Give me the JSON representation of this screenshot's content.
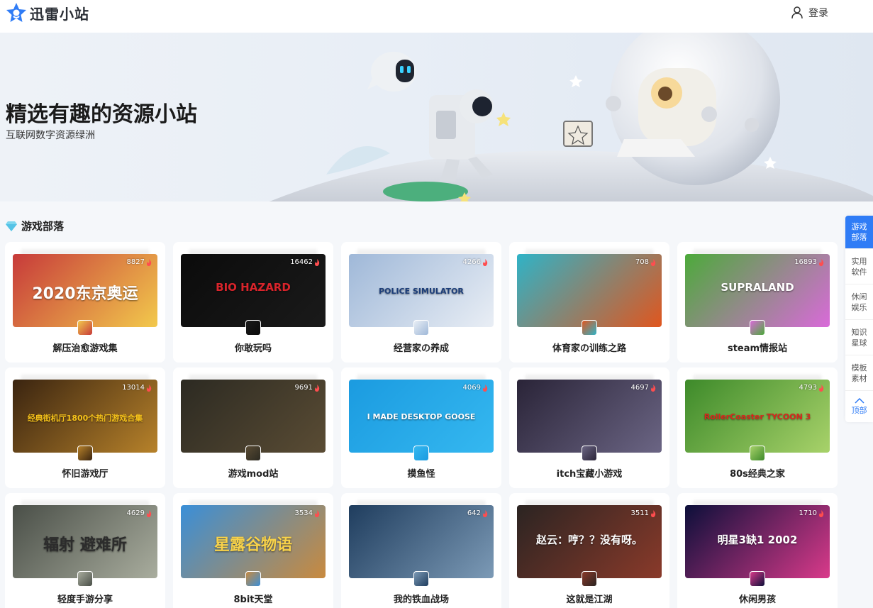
{
  "header": {
    "logo_text": "迅雷小站",
    "logo_icon": "star-shield-icon",
    "login_label": "登录",
    "login_icon": "user-icon",
    "brand_color": "#2f7cf6"
  },
  "banner": {
    "title": "精选有趣的资源小站",
    "subtitle": "互联网数字资源绿洲"
  },
  "section": {
    "title": "游戏部落",
    "icon": "diamond-icon"
  },
  "cards": [
    {
      "name": "解压治愈游戏集",
      "count": "8827",
      "thumb_text": "2020东京奥运",
      "bg": "#c73a3a",
      "bg2": "#f2c94c",
      "text_color": "#ffffff"
    },
    {
      "name": "你敢玩吗",
      "count": "16462",
      "thumb_text": "BIO HAZARD",
      "bg": "#0b0b0b",
      "bg2": "#1a1a1a",
      "text_color": "#d9242b"
    },
    {
      "name": "经营家の养成",
      "count": "4266",
      "thumb_text": "POLICE SIMULATOR",
      "bg": "#9fb8d8",
      "bg2": "#e9eef5",
      "text_color": "#1c3e7a"
    },
    {
      "name": "体育家の训练之路",
      "count": "708",
      "thumb_text": "",
      "bg": "#2fb3c7",
      "bg2": "#e0561e",
      "text_color": "#ffffff"
    },
    {
      "name": "steam情报站",
      "count": "16893",
      "thumb_text": "SUPRALAND",
      "bg": "#4caa3a",
      "bg2": "#d96ad9",
      "text_color": "#ffffff"
    },
    {
      "name": "怀旧游戏厅",
      "count": "13014",
      "thumb_text": "经典街机厅1800个热门游戏合集",
      "bg": "#3a2410",
      "bg2": "#b7822a",
      "text_color": "#f6c21a"
    },
    {
      "name": "游戏mod站",
      "count": "9691",
      "thumb_text": "",
      "bg": "#2c2a22",
      "bg2": "#5a4c34",
      "text_color": "#ffffff"
    },
    {
      "name": "摸鱼怪",
      "count": "4069",
      "thumb_text": "I MADE DESKTOP GOOSE",
      "bg": "#1b9be0",
      "bg2": "#35b8f0",
      "text_color": "#ffffff"
    },
    {
      "name": "itch宝藏小游戏",
      "count": "4697",
      "thumb_text": "",
      "bg": "#2a2438",
      "bg2": "#6b6584",
      "text_color": "#ffffff"
    },
    {
      "name": "80s经典之家",
      "count": "4793",
      "thumb_text": "RollerCoaster TYCOON 3",
      "bg": "#3d8a2a",
      "bg2": "#a8d26a",
      "text_color": "#d9261c"
    },
    {
      "name": "轻度手游分享",
      "count": "4629",
      "thumb_text": "辐射 避难所",
      "bg": "#4a4f48",
      "bg2": "#a9ad9e",
      "text_color": "#2c2c2c"
    },
    {
      "name": "8bit天堂",
      "count": "3534",
      "thumb_text": "星露谷物语",
      "bg": "#3a8fd8",
      "bg2": "#c98a3e",
      "text_color": "#f8d24a"
    },
    {
      "name": "我的铁血战场",
      "count": "642",
      "thumb_text": "",
      "bg": "#1f3d5e",
      "bg2": "#7c9ab6",
      "text_color": "#ffffff"
    },
    {
      "name": "这就是江湖",
      "count": "3511",
      "thumb_text": "赵云：哼？？没有呀。",
      "bg": "#2b2422",
      "bg2": "#8a3a2a",
      "text_color": "#ffffff"
    },
    {
      "name": "休闲男孩",
      "count": "1710",
      "thumb_text": "明星3缺1 2002",
      "bg": "#0c0f3a",
      "bg2": "#d93a8a",
      "text_color": "#ffffff"
    }
  ],
  "side_nav": {
    "items": [
      "游戏部落",
      "实用软件",
      "休闲娱乐",
      "知识星球",
      "模板素材"
    ],
    "top_label": "顶部"
  }
}
